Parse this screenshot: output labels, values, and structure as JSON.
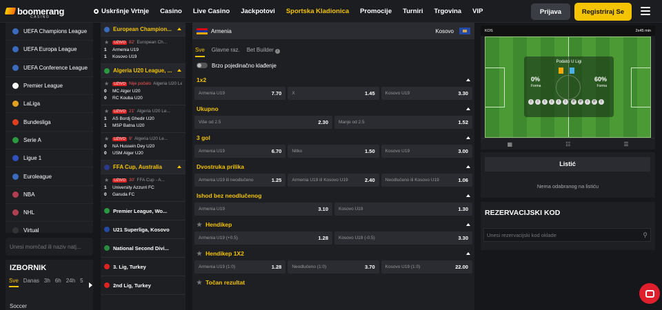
{
  "brand": {
    "name": "boomerang",
    "sub": "CASINO"
  },
  "nav": [
    "Uskršnje Vrtnje",
    "Casino",
    "Live Casino",
    "Jackpotovi",
    "Sportska Kladionica",
    "Promocije",
    "Turniri",
    "Trgovina",
    "VIP"
  ],
  "nav_active": "Sportska Kladionica",
  "auth": {
    "login": "Prijava",
    "register": "Registriraj Se"
  },
  "colors": {
    "accent": "#f5c400",
    "live": "#dd2222",
    "bg": "#15171b"
  },
  "sidebar": {
    "leagues": [
      {
        "label": "UEFA Champions League",
        "flag": "#3a6bbf"
      },
      {
        "label": "UEFA Europa League",
        "flag": "#3a6bbf"
      },
      {
        "label": "UEFA Conference League",
        "flag": "#3a6bbf"
      },
      {
        "label": "Premier League",
        "flag": "#ffffff"
      },
      {
        "label": "LaLiga",
        "flag": "#e0a020"
      },
      {
        "label": "Bundesliga",
        "flag": "#e04020"
      },
      {
        "label": "Serie A",
        "flag": "#2a9a40"
      },
      {
        "label": "Ligue 1",
        "flag": "#3050c0"
      },
      {
        "label": "Euroleague",
        "flag": "#3a6bbf"
      },
      {
        "label": "NBA",
        "flag": "#b04050"
      },
      {
        "label": "NHL",
        "flag": "#b04050"
      },
      {
        "label": "Virtual",
        "flag": "#333333"
      }
    ],
    "search_placeholder": "Unesi momčad ili naziv natj...",
    "izbornik": {
      "title": "IZBORNIK",
      "tabs": [
        "Sve",
        "Danas",
        "3h",
        "6h",
        "24h",
        "5"
      ],
      "row": "Soccer"
    }
  },
  "events": {
    "groups": [
      {
        "title": "European Champion...",
        "matches": [
          {
            "live": "UŽIVO",
            "min": "82'",
            "league": "European Ch...",
            "home": {
              "score": "1",
              "name": "Armenia U19"
            },
            "away": {
              "score": "1",
              "name": "Kosovo U19"
            }
          }
        ]
      },
      {
        "title": "Algeria U20 League, ...",
        "matches": [
          {
            "live": "UŽIVO",
            "min": "Nije počelo",
            "league": "Algeria U20 Le...",
            "home": {
              "score": "0",
              "name": "MC Alger U20"
            },
            "away": {
              "score": "0",
              "name": "RC Kouba U20"
            }
          },
          {
            "live": "UŽIVO",
            "min": "21'",
            "league": "Algeria U20 Le...",
            "home": {
              "score": "1",
              "name": "AS Bordj Ghedir U20"
            },
            "away": {
              "score": "1",
              "name": "MSP Batna U20"
            }
          },
          {
            "live": "UŽIVO",
            "min": "9'",
            "league": "Algeria U20 Le...",
            "home": {
              "score": "0",
              "name": "NA Hussein Dey U20"
            },
            "away": {
              "score": "0",
              "name": "USM Alger U20"
            }
          }
        ]
      },
      {
        "title": "FFA Cup, Australia",
        "matches": [
          {
            "live": "UŽIVO",
            "min": "30'",
            "league": "FFA Cup - A...",
            "home": {
              "score": "1",
              "name": "University Azzurri FC"
            },
            "away": {
              "score": "0",
              "name": "Garuda FC"
            }
          }
        ]
      }
    ],
    "other_leagues": [
      "Premier League, Wo...",
      "U21 Superliga, Kosovo",
      "National Second Divi...",
      "3. Lig, Turkey",
      "2nd Lig, Turkey"
    ]
  },
  "match": {
    "home": "Armenia",
    "away": "Kosovo",
    "tabs": [
      "Sve",
      "Glavne raz.",
      "Bet Builder"
    ],
    "toggle_label": "Brzo pojedinačno klađenje",
    "markets": [
      {
        "title": "1x2",
        "odds": [
          [
            "Armenia U19",
            "7.70"
          ],
          [
            "X",
            "1.45"
          ],
          [
            "Kosovo U19",
            "3.30"
          ]
        ]
      },
      {
        "title": "Ukupno",
        "odds": [
          [
            "Više od 2.5",
            "2.30"
          ],
          [
            "Manje od 2.5",
            "1.52"
          ]
        ]
      },
      {
        "title": "3 gol",
        "odds": [
          [
            "Armenia U19",
            "6.70"
          ],
          [
            "Nitko",
            "1.50"
          ],
          [
            "Kosovo U19",
            "3.00"
          ]
        ]
      },
      {
        "title": "Dvostruka prilika",
        "odds": [
          [
            "Armenia U19 ili neodlučeno",
            "1.25"
          ],
          [
            "Armenia U19 ili Kosovo U19",
            "2.40"
          ],
          [
            "Neodlučeno ili Kosovo U19",
            "1.06"
          ]
        ]
      },
      {
        "title": "Ishod bez neodlučenog",
        "odds": [
          [
            "Armenia U19",
            "3.10"
          ],
          [
            "Kosovo U19",
            "1.30"
          ]
        ]
      },
      {
        "title": "Hendikep",
        "odds": [
          [
            "Armenia U19 (+0.5)",
            "1.28"
          ],
          [
            "Kosovo U19 (-0.5)",
            "3.30"
          ]
        ]
      },
      {
        "title": "Hendikep 1X2",
        "odds": [
          [
            "Armenia U19 (1:0)",
            "1.28"
          ],
          [
            "Neodlučeno (1:0)",
            "3.70"
          ],
          [
            "Kosovo U19 (1:0)",
            "22.00"
          ]
        ]
      },
      {
        "title": "Točan rezultat",
        "odds": []
      }
    ]
  },
  "tracker": {
    "label": "KOS",
    "time": "2x45 min",
    "overlay_title": "Podatci U Ligi",
    "left_pct": "0%",
    "right_pct": "60%",
    "forma": "Forma",
    "home_form": [
      "I",
      "I",
      "I",
      "I",
      "I",
      "I"
    ],
    "away_form": [
      "P",
      "P",
      "I",
      "P",
      "I"
    ]
  },
  "slip": {
    "tab": "Listić",
    "empty": "Nema odabranog na listiću"
  },
  "reservation": {
    "title": "REZERVACIJSKI KOD",
    "placeholder": "Unesi rezervacijski kod oklade"
  }
}
